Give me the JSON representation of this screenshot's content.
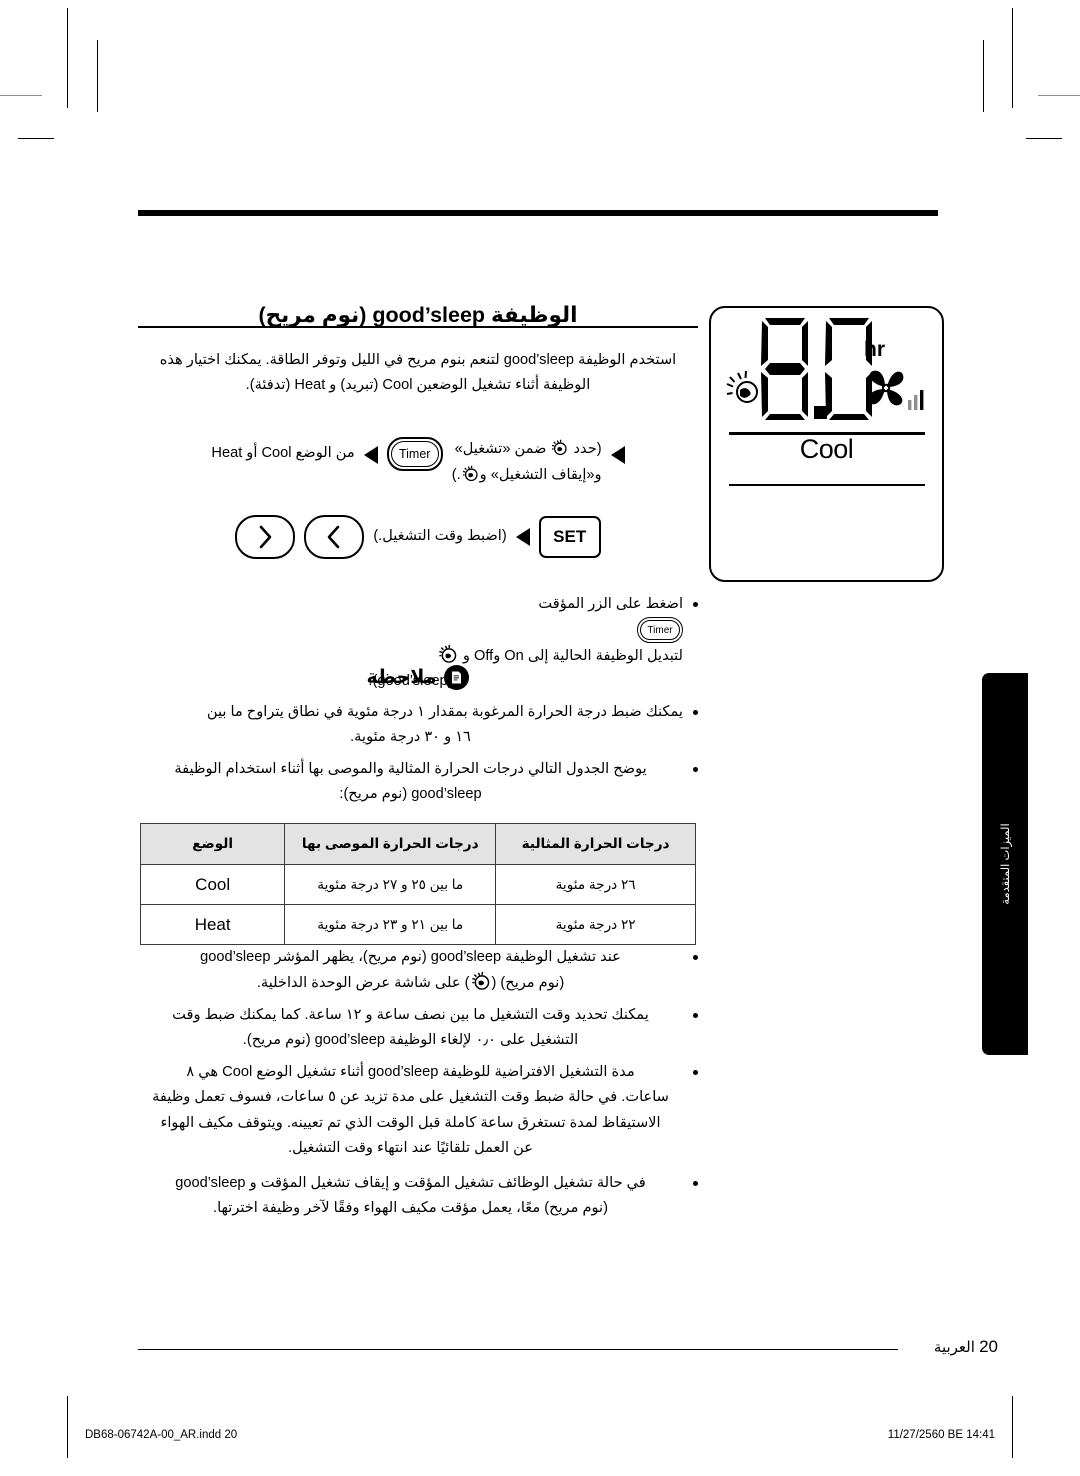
{
  "document": {
    "language": "ar",
    "page_number": "20",
    "footer_label": "العربية",
    "imprint_left": "DB68-06742A-00_AR.indd   20",
    "imprint_right": "11/27/2560 BE   14:41"
  },
  "side_tab": {
    "label": "الميزات المتقدمة",
    "color": "#000000"
  },
  "heading": {
    "text": "الوظيفة good’sleep (نوم مريح)"
  },
  "intro": {
    "line1": "استخدم الوظيفة good’sleep لتنعم بنوم مريح في الليل وتوفر الطاقة. يمكنك اختيار هذه",
    "line2": "الوظيفة أثناء تشغيل الوضعين Cool (تبريد) و Heat (تدفئة)."
  },
  "steps": [
    {
      "id": "step-mode",
      "arrow_icon": "triangle-left-icon",
      "button_label": "Timer",
      "button_icon": "timer-button",
      "text_right": "من الوضع Cool أو Heat",
      "text_left_line1": "(حدد ",
      "text_left_line1_end": " ضمن «تشغيل»",
      "text_left_line2_start": "و«إيقاف التشغيل» و",
      "text_left_line2_end": ".)",
      "sleep_icon": "goodsleep-icon",
      "trailing_arrow_icon": "triangle-left-icon"
    },
    {
      "id": "step-set",
      "button_label": "SET",
      "arrow_icon": "triangle-left-icon",
      "text": "(اضبط وقت التشغيل.)",
      "left_arrow_icon": "chevron-left-icon",
      "right_arrow_icon": "chevron-right-icon"
    }
  ],
  "timer_bullet": {
    "dot": "bullet-dot",
    "line1_a": "اضغط على الزر المؤقت ",
    "button_label": "Timer",
    "line1_b": " لتبديل الوظيفة الحالية إلى On وOff و ",
    "sleep_icon": "goodsleep-icon",
    "line2": "(good’sleep)."
  },
  "note": {
    "icon": "note-document-icon",
    "title": "ملاحظة",
    "bullets": [
      {
        "line1": "يمكنك ضبط درجة الحرارة المرغوبة بمقدار ١ درجة مئوية في نطاق يتراوح ما بين",
        "line2": "١٦ و ٣٠ درجة مئوية."
      },
      {
        "line1": "يوضح الجدول التالي درجات الحرارة المثالية والموصى بها أثناء استخدام الوظيفة",
        "line2": "good’sleep (نوم مريح):"
      }
    ]
  },
  "table": {
    "headers": [
      "الوضع",
      "درجات الحرارة الموصى بها",
      "درجات الحرارة المثالية"
    ],
    "rows": [
      {
        "mode": "Cool",
        "recommended": "ما بين ٢٥ و ٢٧ درجة مئوية",
        "ideal": "٢٦ درجة مئوية"
      },
      {
        "mode": "Heat",
        "recommended": "ما بين ٢١ و ٢٣ درجة مئوية",
        "ideal": "٢٢ درجة مئوية"
      }
    ]
  },
  "post_table_bullets": [
    {
      "id": "bullet-indicator",
      "line1": "عند تشغيل الوظيفة good’sleep (نوم مريح)، يظهر المؤشر good’sleep",
      "line2_a": "(نوم مريح) (",
      "sleep_icon": "goodsleep-icon",
      "line2_b": ") على شاشة عرض الوحدة الداخلية."
    },
    {
      "id": "bullet-duration",
      "line1": "يمكنك تحديد وقت التشغيل ما بين نصف ساعة و ١٢ ساعة. كما يمكنك ضبط وقت",
      "line2": "التشغيل على ٠٫٠ لإلغاء الوظيفة good’sleep (نوم مريح)."
    },
    {
      "id": "bullet-default-time",
      "line1": "مدة التشغيل الافتراضية للوظيفة good’sleep أثناء تشغيل الوضع Cool هي ٨",
      "line2": "ساعات. في حالة ضبط وقت التشغيل على مدة تزيد عن ٥ ساعات، فسوف تعمل وظيفة",
      "line3": "الاستيقاظ لمدة تستغرق ساعة كاملة قبل الوقت الذي تم تعيينه. ويتوقف مكيف الهواء",
      "line4": "عن العمل تلقائيًا عند انتهاء وقت التشغيل."
    },
    {
      "id": "bullet-combined",
      "line1": "في حالة تشغيل الوظائف تشغيل المؤقت و إيقاف تشغيل المؤقت و good’sleep",
      "line2": "(نوم مريح) معًا، يعمل مؤقت مكيف الهواء وفقًا لآخر وظيفة اخترتها."
    }
  ],
  "display_panel": {
    "name": "remote-display-panel",
    "timer_value": "8.0",
    "unit_label": "hr",
    "mode_label": "Cool",
    "icons": {
      "sleep": "goodsleep-icon",
      "fan": "fan-icon",
      "fan_speed_bars": "fan-speed-bars-icon"
    }
  }
}
